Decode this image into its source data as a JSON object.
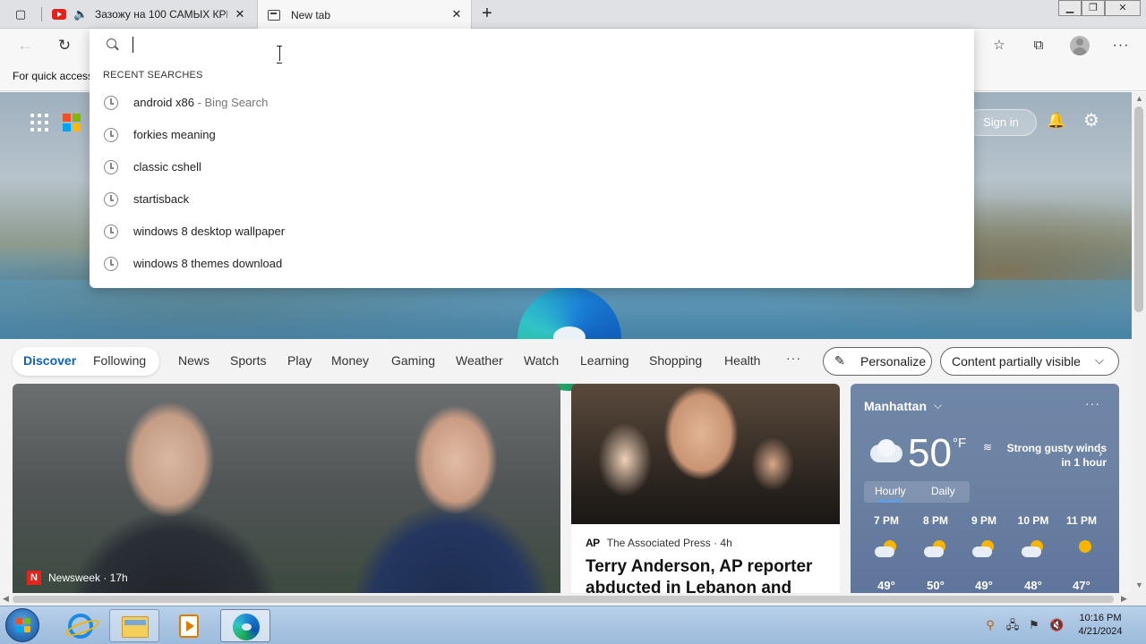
{
  "tabs": [
    {
      "title": "Зазожу на 100 САМЫХ КРИ",
      "audio": true
    },
    {
      "title": "New tab",
      "active": true
    }
  ],
  "favorites_bar": {
    "text": "For quick access"
  },
  "search_popup": {
    "input_value": "",
    "header": "RECENT SEARCHES",
    "items": [
      {
        "text": "android x86",
        "suffix": " - Bing Search"
      },
      {
        "text": "forkies meaning",
        "suffix": ""
      },
      {
        "text": "classic cshell",
        "suffix": ""
      },
      {
        "text": "startisback",
        "suffix": ""
      },
      {
        "text": "windows 8 desktop wallpaper",
        "suffix": ""
      },
      {
        "text": "windows 8 themes download",
        "suffix": ""
      }
    ]
  },
  "hero": {
    "sign_in": "Sign in"
  },
  "feed_nav": {
    "discover": "Discover",
    "following": "Following",
    "links": [
      "News",
      "Sports",
      "Play",
      "Money",
      "Gaming",
      "Weather",
      "Watch",
      "Learning",
      "Shopping",
      "Health"
    ],
    "more": "···",
    "personalize": "Personalize",
    "content_filter": "Content partially visible"
  },
  "main_card": {
    "source": "Newsweek · 17h",
    "source_logo": "N"
  },
  "story_card": {
    "source_logo": "AP",
    "source": "The Associated Press · 4h",
    "headline": "Terry Anderson, AP reporter abducted in Lebanon and"
  },
  "weather": {
    "city": "Manhattan",
    "temp": "50",
    "unit": "°F",
    "wind": "Strong gusty winds in 1 hour",
    "tab_hourly": "Hourly",
    "tab_daily": "Daily",
    "hours": [
      {
        "time": "7 PM",
        "temp": "49°"
      },
      {
        "time": "8 PM",
        "temp": "50°"
      },
      {
        "time": "9 PM",
        "temp": "49°"
      },
      {
        "time": "10 PM",
        "temp": "48°"
      },
      {
        "time": "11 PM",
        "temp": "47°"
      }
    ]
  },
  "clock": {
    "time": "10:16 PM",
    "date": "4/21/2024"
  }
}
